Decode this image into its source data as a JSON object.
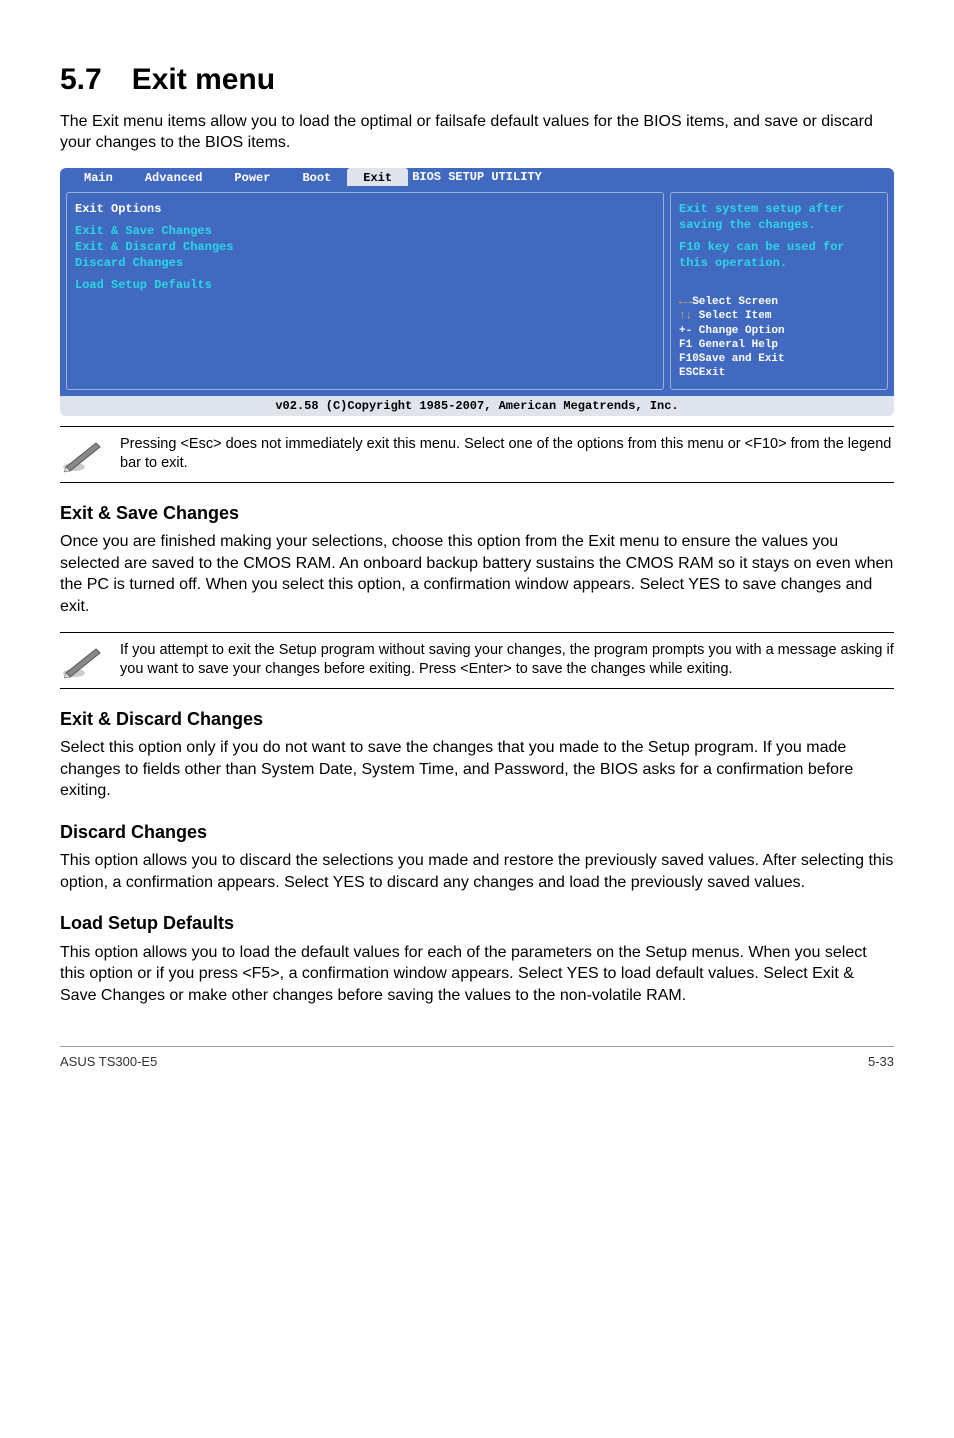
{
  "title": {
    "num": "5.7",
    "text": "Exit menu"
  },
  "intro": "The Exit menu items allow you to load the optimal or failsafe default values for the BIOS items, and save or discard your changes to the BIOS items.",
  "bios": {
    "title": "BIOS SETUP UTILITY",
    "tabs": {
      "main": "Main",
      "advanced": "Advanced",
      "power": "Power",
      "boot": "Boot",
      "exit": "Exit"
    },
    "left": {
      "header": "Exit Options",
      "items": {
        "save": "Exit & Save Changes",
        "discardexit": "Exit & Discard Changes",
        "discard": "Discard Changes",
        "load": "Load Setup Defaults"
      }
    },
    "right": {
      "help1": "Exit system setup after saving the changes.",
      "help2": "F10 key can be used for this operation.",
      "nav": {
        "l1_pre": "←→",
        "l1": "Select Screen",
        "l2_pre": "↑↓",
        "l2": " Select Item",
        "l3": "+- Change Option",
        "l4": "F1 General Help",
        "l5": "F10Save and Exit",
        "l6": "ESCExit"
      }
    },
    "footer": "v02.58 (C)Copyright 1985-2007, American Megatrends, Inc."
  },
  "note1": "Pressing <Esc> does not immediately exit this menu. Select one of the options from this menu or <F10> from the legend bar to exit.",
  "s1": {
    "h": "Exit & Save Changes",
    "p": "Once you are finished making your selections, choose this option from the Exit menu to ensure the values you selected are saved to the CMOS RAM. An onboard backup battery sustains the CMOS RAM so it stays on even when the PC is turned off. When you select this option, a confirmation window appears. Select YES to save changes and exit."
  },
  "note2": " If you attempt to exit the Setup program without saving your changes, the program prompts you with a message asking if you want to save your changes before exiting. Press <Enter>  to save the  changes while exiting.",
  "s2": {
    "h": "Exit & Discard Changes",
    "p": "Select this option only if you do not want to save the changes that you  made to the Setup program. If you made changes to fields other than System Date, System Time, and Password, the BIOS asks for a confirmation before exiting."
  },
  "s3": {
    "h": "Discard Changes",
    "p": "This option allows you to discard the selections you made and restore the previously saved values. After selecting this option, a confirmation appears. Select YES to discard any changes and load the previously saved values."
  },
  "s4": {
    "h": "Load Setup Defaults",
    "p": "This option allows you to load the default values for each of the parameters on the Setup menus. When you select this option or if you press <F5>, a confirmation window appears. Select YES to load default values. Select Exit & Save Changes or make other changes before saving the values to the non-volatile RAM."
  },
  "footer": {
    "left": "ASUS TS300-E5",
    "right": "5-33"
  }
}
